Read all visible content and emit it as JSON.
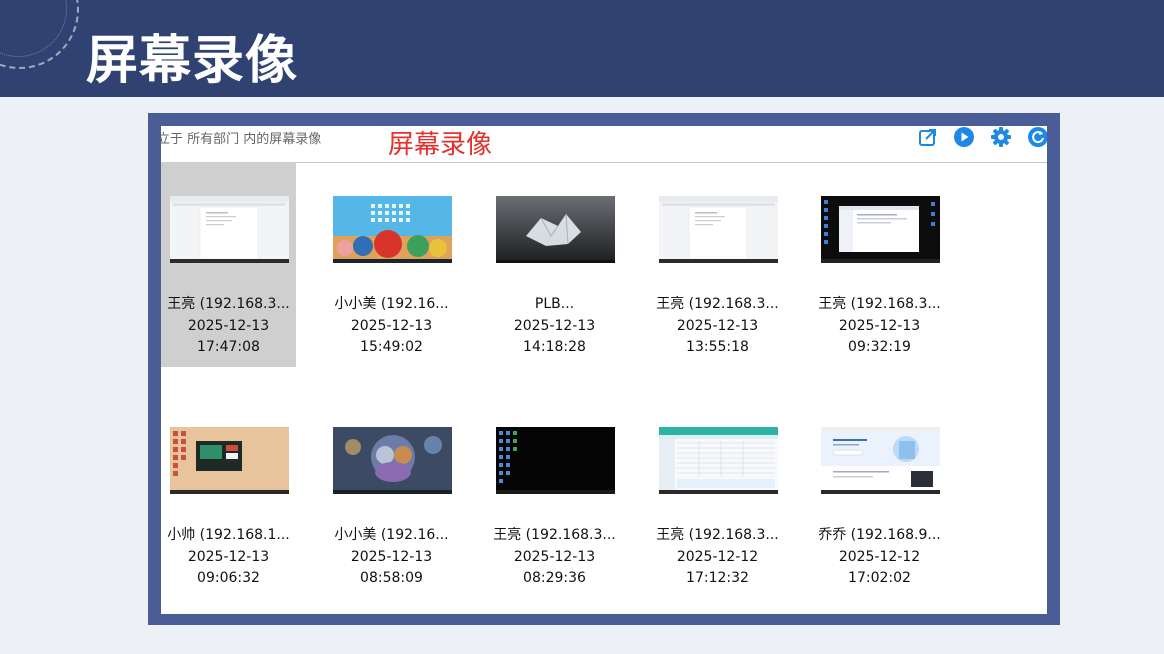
{
  "slide": {
    "title": "屏幕录像"
  },
  "window": {
    "location_text": "立于 所有部门 内的屏幕录像",
    "overlay_label": "屏幕录像",
    "toolbar_icons": [
      "export-icon",
      "play-icon",
      "settings-icon",
      "refresh-icon"
    ],
    "accent_color": "#1e88e5"
  },
  "recordings": [
    {
      "name": "王亮 (192.168.3...",
      "date": "2025-12-13",
      "time": "17:47:08",
      "thumb": "document-window",
      "selected": true
    },
    {
      "name": "小小美 (192.16...",
      "date": "2025-12-13",
      "time": "15:49:02",
      "thumb": "anime-desktop",
      "selected": false
    },
    {
      "name": "PLB...",
      "date": "2025-12-13",
      "time": "14:18:28",
      "thumb": "ice-wallpaper",
      "selected": false
    },
    {
      "name": "王亮 (192.168.3...",
      "date": "2025-12-13",
      "time": "13:55:18",
      "thumb": "document-window",
      "selected": false
    },
    {
      "name": "王亮 (192.168.3...",
      "date": "2025-12-13",
      "time": "09:32:19",
      "thumb": "dark-desktop-window",
      "selected": false
    },
    {
      "name": "小帅 (192.168.1...",
      "date": "2025-12-13",
      "time": "09:06:32",
      "thumb": "tan-desktop",
      "selected": false
    },
    {
      "name": "小小美 (192.16...",
      "date": "2025-12-13",
      "time": "08:58:09",
      "thumb": "cartoon-wallpaper",
      "selected": false
    },
    {
      "name": "王亮 (192.168.3...",
      "date": "2025-12-13",
      "time": "08:29:36",
      "thumb": "dark-desktop",
      "selected": false
    },
    {
      "name": "王亮 (192.168.3...",
      "date": "2025-12-12",
      "time": "17:12:32",
      "thumb": "spreadsheet-window",
      "selected": false
    },
    {
      "name": "乔乔 (192.168.9...",
      "date": "2025-12-12",
      "time": "17:02:02",
      "thumb": "web-page",
      "selected": false
    }
  ]
}
